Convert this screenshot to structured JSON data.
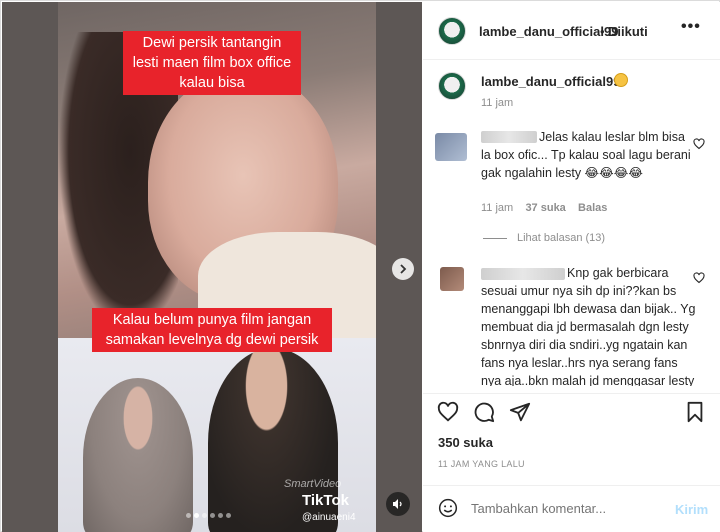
{
  "media": {
    "caption_top": "Dewi persik tantangin lesti maen film box office kalau bisa",
    "caption_bottom": "Kalau belum punya film jangan samakan levelnya dg dewi persik",
    "tiktok_brand": "TikTok",
    "tiktok_handle": "@ainuaeni4",
    "watermark": "SmartVideo",
    "carousel_dots": 6,
    "active_dot": 1,
    "icons": [
      "chevron-right-icon",
      "speaker-icon"
    ]
  },
  "header": {
    "username": "lambe_danu_official99",
    "separator": "•",
    "follow_label": "Diikuti",
    "more_label": "•••"
  },
  "caption": {
    "username": "lambe_danu_official99",
    "time": "11 jam"
  },
  "comments": [
    {
      "text": "Jelas kalau leslar blm bisa la box ofic... Tp kalau soal lagu berani gak ngalahin lesty 😂😂😂😂",
      "time": "11 jam",
      "likes": "37 suka",
      "reply": "Balas"
    },
    {
      "text": "Knp gak berbicara sesuai umur nya sih dp ini??kan bs menanggapi lbh dewasa dan bijak.. Yg membuat dia jd bermasalah dgn lesty sbnrnya diri dia sndiri..yg ngatain kan fans nya leslar..hrs nya serang fans nya aja..bkn malah jd menggasar lesty nya..makin klo dia"
    }
  ],
  "view_replies": "Lihat balasan (13)",
  "actions": {
    "icons": [
      "heart-icon",
      "comment-icon",
      "share-icon",
      "bookmark-icon"
    ]
  },
  "likes": "350 suka",
  "posted": "11 JAM YANG LALU",
  "comment_input": {
    "placeholder": "Tambahkan komentar...",
    "send_label": "Kirim"
  }
}
